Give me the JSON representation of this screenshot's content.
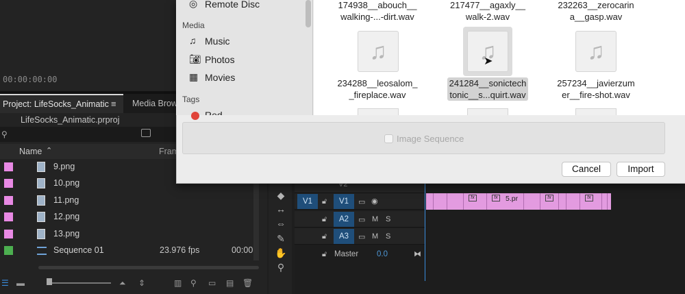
{
  "monitor": {
    "timecode": "00:00:00:00"
  },
  "project_panel": {
    "tab_title": "Project: LifeSocks_Animatic",
    "tab_menu": "≡",
    "media_tab": "Media Brow",
    "file_name": "LifeSocks_Animatic.prproj",
    "columns": {
      "name": "Name",
      "frame_rate": "Fram"
    },
    "items": [
      {
        "name": "9.png",
        "color": "#e889e4"
      },
      {
        "name": "10.png",
        "color": "#e889e4"
      },
      {
        "name": "11.png",
        "color": "#e889e4"
      },
      {
        "name": "12.png",
        "color": "#e889e4"
      },
      {
        "name": "13.png",
        "color": "#e889e4"
      }
    ],
    "sequence": {
      "name": "Sequence 01",
      "fps": "23.976 fps",
      "trail": "00:00",
      "color": "#4caf50"
    }
  },
  "timeline": {
    "tracks": [
      {
        "src": "",
        "tgt": "V2",
        "dim": true
      },
      {
        "src": "V1",
        "tgt": "V1"
      },
      {
        "src": "",
        "tgt": "A2",
        "m": "M",
        "s": "S"
      },
      {
        "src": "",
        "tgt": "A3",
        "m": "M",
        "s": "S"
      }
    ],
    "master_label": "Master",
    "master_value": "0.0",
    "clip_label": "5.pr",
    "clip_color": "#e39be0"
  },
  "dialog": {
    "sidebar": {
      "remote_disc": "Remote Disc",
      "media_section": "Media",
      "music": "Music",
      "photos": "Photos",
      "movies": "Movies",
      "tags_section": "Tags",
      "red_tag": "Red"
    },
    "files_row1": [
      {
        "line1": "174938__abouch__",
        "line2": "walking-...-dirt.wav"
      },
      {
        "line1": "217477__agaxly__",
        "line2": "walk-2.wav"
      },
      {
        "line1": "232263__zerocarin",
        "line2": "a__gasp.wav"
      }
    ],
    "files_row2": [
      {
        "line1": "234288__leosalom_",
        "line2": "_fireplace.wav",
        "selected": false
      },
      {
        "line1": "241284__sonictech",
        "line2": "tonic__s...quirt.wav",
        "selected": true
      },
      {
        "line1": "257234__javierzum",
        "line2": "er__fire-shot.wav",
        "selected": false
      }
    ],
    "image_sequence_label": "Image Sequence",
    "cancel_label": "Cancel",
    "import_label": "Import"
  }
}
